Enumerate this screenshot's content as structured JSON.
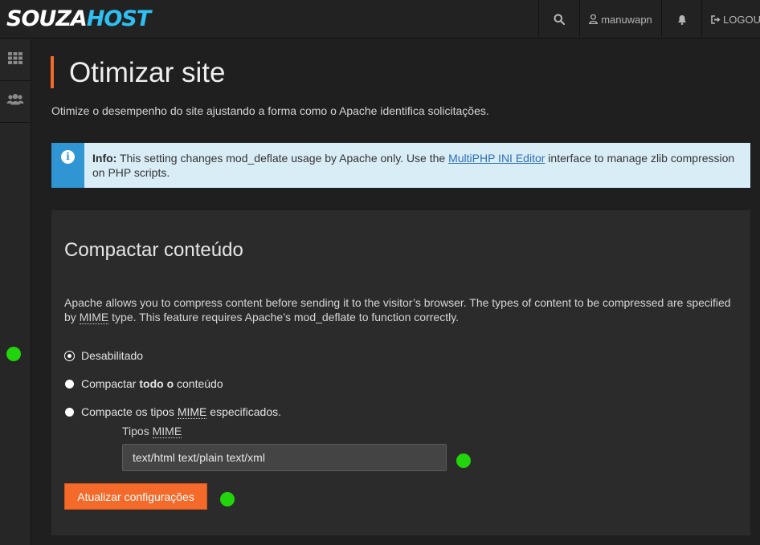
{
  "brand": {
    "part1": "SOUZA",
    "part2": "HOST"
  },
  "topbar": {
    "username": "manuwapn",
    "logout_label": "LOGOUT"
  },
  "page": {
    "title": "Otimizar site",
    "description": "Otimize o desempenho do site ajustando a forma como o Apache identifica solicitações."
  },
  "info": {
    "label": "Info:",
    "text_before": " This setting changes mod_deflate usage by Apache only. Use the ",
    "link": "MultiPHP INI Editor",
    "text_after": " interface to manage zlib compression on PHP scripts."
  },
  "panel": {
    "title": "Compactar conteúdo",
    "desc_before": "Apache allows you to compress content before sending it to the visitor’s browser. The types of content to be compressed are specified by ",
    "desc_abbr": "MIME",
    "desc_after": " type. This feature requires Apache’s mod_deflate to function correctly.",
    "options": {
      "disabled": "Desabilitado",
      "all_before": "Compactar ",
      "all_bold": "todo o",
      "all_after": " conteúdo",
      "specific_before": "Compacte os tipos ",
      "specific_abbr": "MIME",
      "specific_after": " especificados."
    },
    "selected_option": "disabled",
    "mime_label": "Tipos ",
    "mime_label_abbr": "MIME",
    "mime_value": "text/html text/plain text/xml",
    "submit_label": "Atualizar configurações"
  },
  "colors": {
    "accent": "#f36a2a",
    "info_bg": "#d9edf7",
    "info_icon_bg": "#2f96d3",
    "marker": "#22d40b",
    "brand_blue": "#2ec0f2"
  },
  "icons": [
    "search-icon",
    "user-icon",
    "bell-icon",
    "logout-icon",
    "grid-icon",
    "users-icon",
    "info-icon"
  ]
}
